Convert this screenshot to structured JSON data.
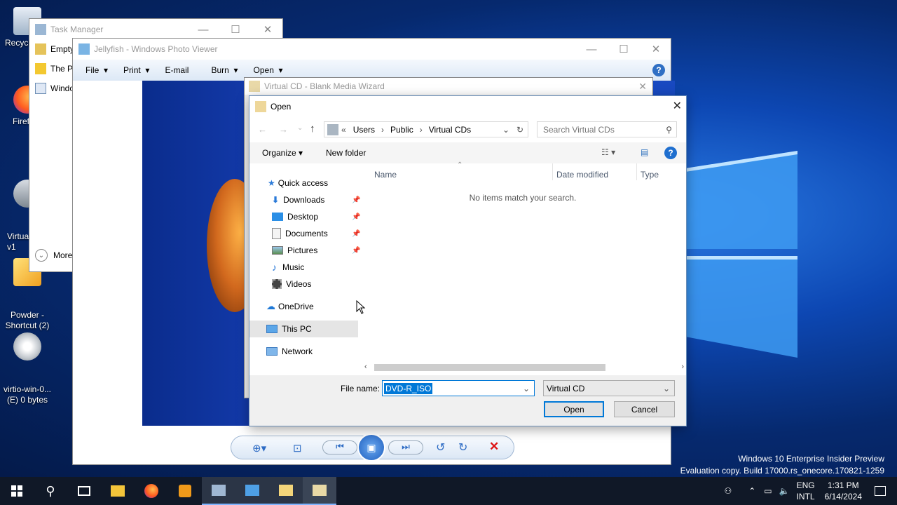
{
  "desktop": {
    "icons": [
      {
        "label": "Recycl"
      },
      {
        "label": "Firef"
      },
      {
        "label": "Virtua\nv1"
      },
      {
        "label": "Powder -\nShortcut (2)"
      },
      {
        "label": "virtio-win-0...\n(E) 0 bytes"
      }
    ]
  },
  "task_manager": {
    "title": "Task Manager",
    "rows": [
      "Empty",
      "The Po",
      "Windo"
    ],
    "more": "More"
  },
  "photo_viewer": {
    "title": "Jellyfish - Windows Photo Viewer",
    "menu": [
      "File",
      "Print",
      "E-mail",
      "Burn",
      "Open"
    ]
  },
  "wizard": {
    "title": "Virtual CD - Blank Media Wizard"
  },
  "open_dialog": {
    "title": "Open",
    "breadcrumb": [
      "Users",
      "Public",
      "Virtual CDs"
    ],
    "breadcrumb_prefix": "«",
    "search_placeholder": "Search Virtual CDs",
    "organize": "Organize",
    "new_folder": "New folder",
    "columns": {
      "name": "Name",
      "date": "Date modified",
      "type": "Type"
    },
    "empty_message": "No items match your search.",
    "nav": {
      "quick_access": "Quick access",
      "downloads": "Downloads",
      "desktop": "Desktop",
      "documents": "Documents",
      "pictures": "Pictures",
      "music": "Music",
      "videos": "Videos",
      "onedrive": "OneDrive",
      "this_pc": "This PC",
      "network": "Network"
    },
    "file_name_label": "File name:",
    "file_name_value": "DVD-R_ISO",
    "file_type": "Virtual CD",
    "open_button": "Open",
    "cancel_button": "Cancel"
  },
  "watermark": {
    "line1": "Windows 10 Enterprise Insider Preview",
    "line2": "Evaluation copy. Build 17000.rs_onecore.170821-1259"
  },
  "tray": {
    "lang1": "ENG",
    "lang2": "INTL",
    "time": "1:31 PM",
    "date": "6/14/2024"
  },
  "colors": {
    "accent": "#0078d7",
    "selection": "#3399ff",
    "desktop": "#0d47b3"
  }
}
